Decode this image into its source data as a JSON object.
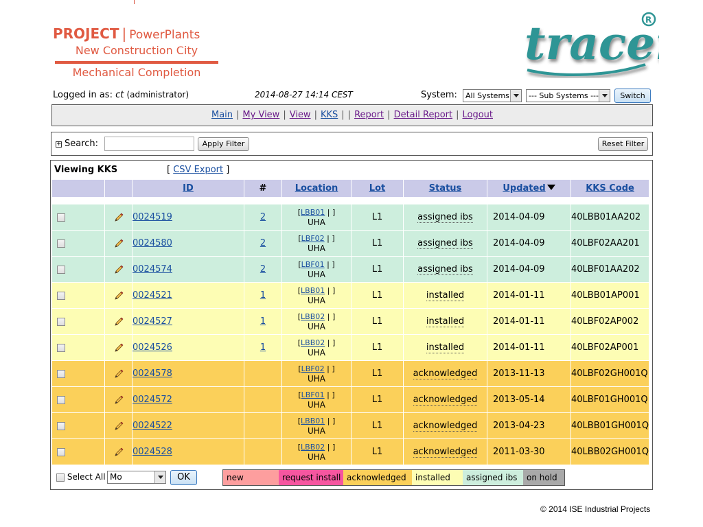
{
  "header": {
    "project_label": "PROJECT",
    "separator": "|",
    "project_name": "PowerPlants",
    "site": "New Construction City",
    "module": "Mechanical Completion"
  },
  "logo": {
    "text": "tracer",
    "mark": "®",
    "color": "#2a8a8a"
  },
  "session": {
    "logged_in_label": "Logged in as:",
    "user": "ct",
    "role": "(administrator)",
    "datetime": "2014-08-27 14:14 CEST"
  },
  "system": {
    "label": "System:",
    "system_value": "All Systems",
    "subsystem_value": "--- Sub Systems ---",
    "switch_label": "Switch"
  },
  "nav": {
    "items": [
      {
        "label": "Main"
      },
      {
        "label": "My View"
      },
      {
        "label": "View"
      },
      {
        "label": "KKS"
      },
      {
        "label": "Report"
      },
      {
        "label": "Detail Report"
      },
      {
        "label": "Logout"
      }
    ]
  },
  "search": {
    "label": "Search:",
    "value": "",
    "apply_label": "Apply Filter",
    "reset_label": "Reset Filter"
  },
  "view": {
    "title": "Viewing KKS",
    "csv_open": "[",
    "csv_label": "CSV Export",
    "csv_close": "]"
  },
  "table": {
    "headers": [
      "",
      "",
      "ID",
      "#",
      "Location",
      "Lot",
      "Status",
      "Updated",
      "KKS Code"
    ],
    "rows": [
      {
        "id": "0024519",
        "num": "2",
        "loc_code": "LBB01",
        "loc_area": "UHA",
        "lot": "L1",
        "status": "assigned ibs",
        "updated": "2014-04-09",
        "kks": "40LBB01AA202",
        "group": "ibs"
      },
      {
        "id": "0024580",
        "num": "2",
        "loc_code": "LBF02",
        "loc_area": "UHA",
        "lot": "L1",
        "status": "assigned ibs",
        "updated": "2014-04-09",
        "kks": "40LBF02AA201",
        "group": "ibs"
      },
      {
        "id": "0024574",
        "num": "2",
        "loc_code": "LBF01",
        "loc_area": "UHA",
        "lot": "L1",
        "status": "assigned ibs",
        "updated": "2014-04-09",
        "kks": "40LBF01AA202",
        "group": "ibs"
      },
      {
        "id": "0024521",
        "num": "1",
        "loc_code": "LBB01",
        "loc_area": "UHA",
        "lot": "L1",
        "status": "installed",
        "updated": "2014-01-11",
        "kks": "40LBB01AP001",
        "group": "inst"
      },
      {
        "id": "0024527",
        "num": "1",
        "loc_code": "LBB02",
        "loc_area": "UHA",
        "lot": "L1",
        "status": "installed",
        "updated": "2014-01-11",
        "kks": "40LBF02AP002",
        "group": "inst"
      },
      {
        "id": "0024526",
        "num": "1",
        "loc_code": "LBB02",
        "loc_area": "UHA",
        "lot": "L1",
        "status": "installed",
        "updated": "2014-01-11",
        "kks": "40LBF02AP001",
        "group": "inst"
      },
      {
        "id": "0024578",
        "num": "",
        "loc_code": "LBF02",
        "loc_area": "UHA",
        "lot": "L1",
        "status": "acknowledged",
        "updated": "2013-11-13",
        "kks": "40LBF02GH001Q",
        "group": "ack"
      },
      {
        "id": "0024572",
        "num": "",
        "loc_code": "LBF01",
        "loc_area": "UHA",
        "lot": "L1",
        "status": "acknowledged",
        "updated": "2013-05-14",
        "kks": "40LBF01GH001Q",
        "group": "ack"
      },
      {
        "id": "0024522",
        "num": "",
        "loc_code": "LBB01",
        "loc_area": "UHA",
        "lot": "L1",
        "status": "acknowledged",
        "updated": "2013-04-23",
        "kks": "40LBB01GH001Q",
        "group": "ack"
      },
      {
        "id": "0024528",
        "num": "",
        "loc_code": "LBB02",
        "loc_area": "UHA",
        "lot": "L1",
        "status": "acknowledged",
        "updated": "2011-03-30",
        "kks": "40LBB02GH001Q",
        "group": "ack"
      }
    ]
  },
  "footer": {
    "select_all_label": "Select All",
    "action_value": "Mo",
    "ok_label": "OK",
    "legend": [
      {
        "label": "new",
        "color": "#fd9e9e"
      },
      {
        "label": "request install",
        "color": "#f656a0"
      },
      {
        "label": "acknowledged",
        "color": "#fbd05a"
      },
      {
        "label": "installed",
        "color": "#fdfdb4"
      },
      {
        "label": "assigned ibs",
        "color": "#cdeedd"
      },
      {
        "label": "on hold",
        "color": "#a9a9a9"
      }
    ],
    "copyright": "© 2014 ISE Industrial Projects"
  }
}
